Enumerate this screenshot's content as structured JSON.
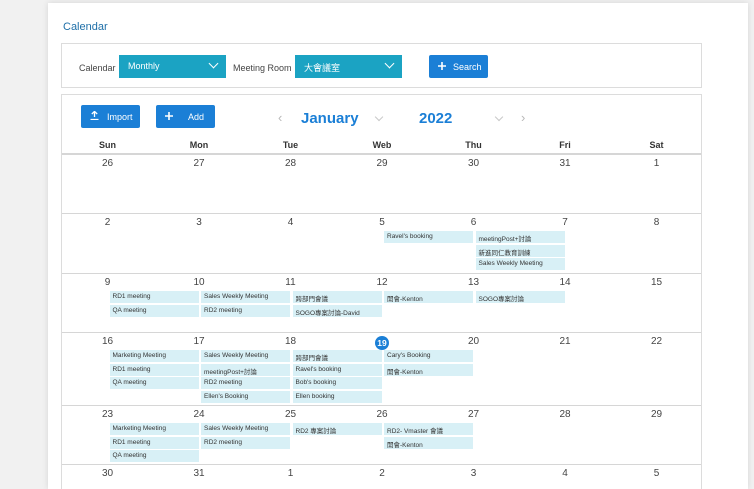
{
  "page_title": "Calendar",
  "filters": {
    "calendar_label": "Calendar",
    "calendar_value": "Monthly",
    "room_label": "Meeting Room",
    "room_value": "大會議室",
    "search_label": "Search"
  },
  "toolbar": {
    "import_label": "Import",
    "add_label": "Add",
    "prev_arrow": "‹",
    "next_arrow": "›",
    "month": "January",
    "year": "2022"
  },
  "weekdays": [
    "Sun",
    "Mon",
    "Tue",
    "Web",
    "Thu",
    "Fri",
    "Sat"
  ],
  "weeks": [
    {
      "days": [
        "26",
        "27",
        "28",
        "29",
        "30",
        "31",
        "1"
      ],
      "events": []
    },
    {
      "days": [
        "2",
        "3",
        "4",
        "5",
        "6",
        "7",
        "8"
      ],
      "events": [
        {
          "col": 4,
          "slot": 0,
          "text": "Ravel's booking"
        },
        {
          "col": 5,
          "slot": 0,
          "text": "meetingPost+討論"
        },
        {
          "col": 5,
          "slot": 1,
          "text": "新進同仁教育訓練"
        },
        {
          "col": 5,
          "slot": 2,
          "text": "Sales Weekly Meeting"
        }
      ]
    },
    {
      "days": [
        "9",
        "10",
        "11",
        "12",
        "13",
        "14",
        "15"
      ],
      "events": [
        {
          "col": 1,
          "slot": 0,
          "text": "RD1 meeting"
        },
        {
          "col": 1,
          "slot": 1,
          "text": "QA meeting"
        },
        {
          "col": 2,
          "slot": 0,
          "text": "Sales Weekly Meeting"
        },
        {
          "col": 2,
          "slot": 1,
          "text": "RD2 meeting"
        },
        {
          "col": 3,
          "slot": 0,
          "text": "跨部門會議"
        },
        {
          "col": 3,
          "slot": 1,
          "text": "SOGO專案討論-David"
        },
        {
          "col": 4,
          "slot": 0,
          "text": "開會-Kenton"
        },
        {
          "col": 5,
          "slot": 0,
          "text": "SOGO專案討論"
        }
      ]
    },
    {
      "days": [
        "16",
        "17",
        "18",
        "19",
        "20",
        "21",
        "22"
      ],
      "today_col": 3,
      "events": [
        {
          "col": 1,
          "slot": 0,
          "text": "Marketing Meeting"
        },
        {
          "col": 1,
          "slot": 1,
          "text": "RD1 meeting"
        },
        {
          "col": 1,
          "slot": 2,
          "text": "QA meeting"
        },
        {
          "col": 2,
          "slot": 0,
          "text": "Sales Weekly Meeting"
        },
        {
          "col": 2,
          "slot": 1,
          "text": "meetingPost+討論"
        },
        {
          "col": 2,
          "slot": 2,
          "text": "RD2 meeting"
        },
        {
          "col": 2,
          "slot": 3,
          "text": "Ellen's Booking"
        },
        {
          "col": 3,
          "slot": 0,
          "text": "跨部門會議"
        },
        {
          "col": 3,
          "slot": 1,
          "text": "Ravel's booking"
        },
        {
          "col": 3,
          "slot": 2,
          "text": "Bob's booking"
        },
        {
          "col": 3,
          "slot": 3,
          "text": "Ellen booking"
        },
        {
          "col": 4,
          "slot": 0,
          "text": "Cary's Booking"
        },
        {
          "col": 4,
          "slot": 1,
          "text": "開會-Kenton"
        }
      ]
    },
    {
      "days": [
        "23",
        "24",
        "25",
        "26",
        "27",
        "28",
        "29"
      ],
      "events": [
        {
          "col": 1,
          "slot": 0,
          "text": "Marketing Meeting"
        },
        {
          "col": 1,
          "slot": 1,
          "text": "RD1 meeting"
        },
        {
          "col": 1,
          "slot": 2,
          "text": "QA meeting"
        },
        {
          "col": 2,
          "slot": 0,
          "text": "Sales Weekly Meeting"
        },
        {
          "col": 2,
          "slot": 1,
          "text": "RD2 meeting"
        },
        {
          "col": 3,
          "slot": 0,
          "text": "RD2 專案討論"
        },
        {
          "col": 4,
          "slot": 0,
          "text": "RD2- Vmaster 會議"
        },
        {
          "col": 4,
          "slot": 1,
          "text": "開會-Kenton"
        }
      ]
    },
    {
      "days": [
        "30",
        "31",
        "1",
        "2",
        "3",
        "4",
        "5"
      ],
      "events": []
    }
  ],
  "colors": {
    "accent": "#1b7fd6",
    "select_bg": "#1ba3c3",
    "event_bg": "#d8f0f6",
    "today": "#1b7fd6"
  }
}
